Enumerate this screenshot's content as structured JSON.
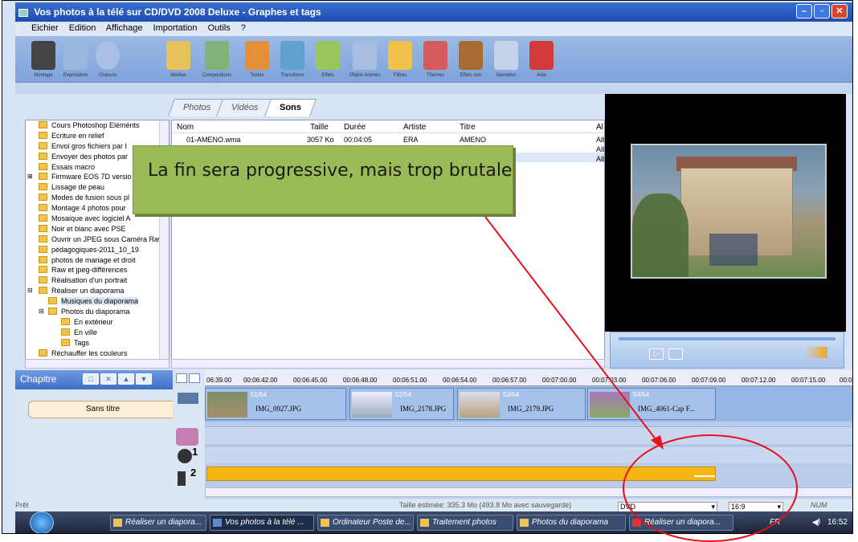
{
  "window": {
    "title": "Vos photos à la télé sur CD/DVD 2008 Deluxe - Graphes et tags"
  },
  "menu": [
    "Eichier",
    "Edition",
    "Affichage",
    "Importation",
    "Outils",
    "?"
  ],
  "toolbar": {
    "items": [
      "Montage",
      "Exportation",
      "Gravure",
      "Médias",
      "Compositions",
      "Textes",
      "Transitions",
      "Effets",
      "Objets Animés",
      "Filtres",
      "Thèmes",
      "Effets son",
      "Narration",
      "Aide"
    ]
  },
  "tabs": [
    "Photos",
    "Vidéos",
    "Sons"
  ],
  "tree": {
    "items": [
      "Cours Photoshop Eléménts",
      "Ecriture en relief",
      "Envoi gros fichiers par I",
      "Envoyer des photos par",
      "Essais macro",
      "Firmware EOS 7D versio",
      "Lissage de peau",
      "Modes de fusion sous pl",
      "Montage 4 photos pour",
      "Mosaique avec logiciel A",
      "Noir et blanc avec PSE",
      "Ouvrir un JPEG sous Caméra Raw",
      "pédagogiques-2011_10_19",
      "photos de mariage et droit",
      "Raw et jpeg-différences",
      "Réalisation d'un portrait",
      "Réaliser un diaporama",
      "Musiques du diaporama",
      "Photos du diaporama",
      "En extérieur",
      "En ville",
      "Tags",
      "Réchauffer les couleurs"
    ]
  },
  "filelist": {
    "columns": [
      "Nom",
      "Taille",
      "Durée",
      "Artiste",
      "Titre",
      "Al"
    ],
    "rows": [
      {
        "nom": "01-AMENO.wma",
        "taille": "3057 Ko",
        "duree": "00:04:05",
        "artiste": "ERA",
        "titre": "AMENO",
        "al": "Alb"
      }
    ],
    "extra_al": [
      "Alb",
      "Alb"
    ]
  },
  "callout": {
    "text": "La fin sera progressive, mais trop brutale"
  },
  "chapter": {
    "title": "Chapitre",
    "item": "Sans titre"
  },
  "timeline": {
    "ticks": [
      "06:39.00",
      "00:06:42.00",
      "00:06:45.00",
      "00:06:48.00",
      "00:06:51.00",
      "00:06:54.00",
      "00:06:57.00",
      "00:07:00.00",
      "00:07:03.00",
      "00:07:06.00",
      "00:07:09.00",
      "00:07:12.00",
      "00:07:15.00",
      "00:0"
    ],
    "clips": [
      {
        "num": "51/54",
        "name": "IMG_0927.JPG"
      },
      {
        "num": "52/54",
        "name": "IMG_2178.JPG"
      },
      {
        "num": "53/54",
        "name": "IMG_2179.JPG"
      },
      {
        "num": "54/54",
        "name": "IMG_4061-Cap F..."
      }
    ],
    "track_numbers": [
      "1",
      "2"
    ]
  },
  "status": {
    "left": "Prêt",
    "size": "Taille estimée: 335.3 Mo  (493.8 Mo avec sauvegarde)",
    "format": "DVD",
    "ratio": "16:9",
    "num": "NUM"
  },
  "taskbar": {
    "items": [
      "Réaliser un diapora...",
      "Vos photos à la télé ...",
      "Ordinateur Poste de...",
      "Traitement photos",
      "Photos du diaporama",
      "Réaliser un diapora..."
    ],
    "lang": "FR",
    "time": "16:52"
  },
  "colors": {
    "callout": "#9bbb59",
    "music_bar": "#f6b715",
    "annotation": "#e8101a"
  }
}
